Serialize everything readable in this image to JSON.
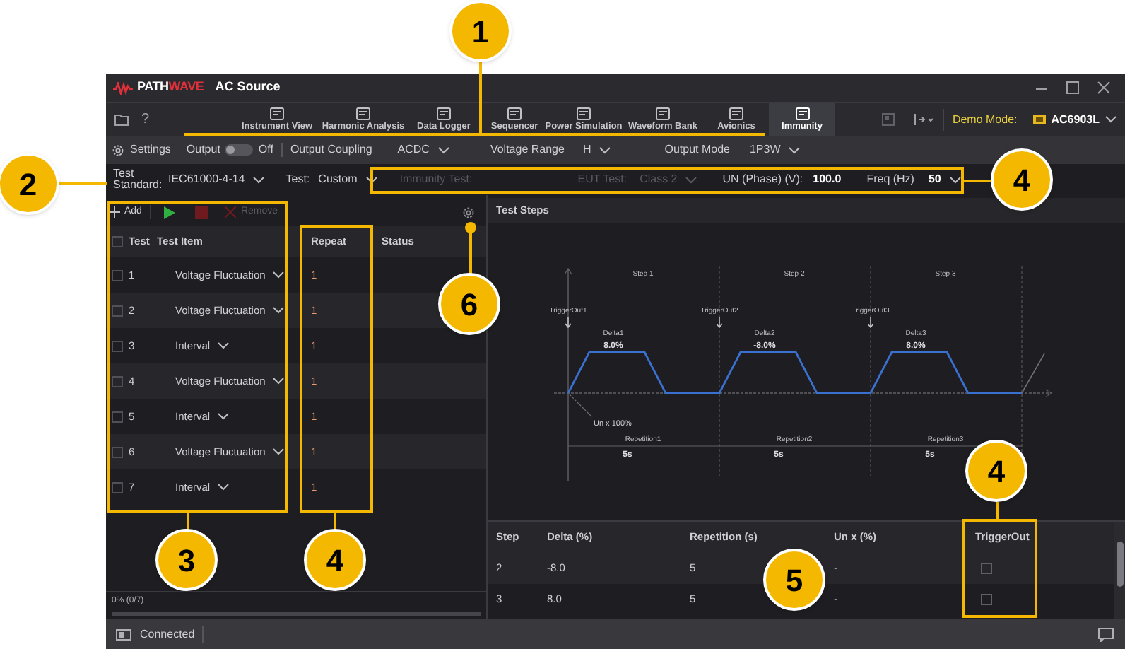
{
  "title_bar": {
    "logo_left": "PATH",
    "logo_right": "WAVE",
    "app_name": "AC Source"
  },
  "toolbar": {
    "tabs": [
      {
        "label": "Instrument View",
        "selected": false
      },
      {
        "label": "Harmonic Analysis",
        "selected": false
      },
      {
        "label": "Data Logger",
        "selected": false
      },
      {
        "label": "Sequencer",
        "selected": false
      },
      {
        "label": "Power Simulation",
        "selected": false
      },
      {
        "label": "Waveform Bank",
        "selected": false
      },
      {
        "label": "Avionics",
        "selected": false
      },
      {
        "label": "Immunity",
        "selected": true
      }
    ],
    "help": "?",
    "demo_mode_label": "Demo Mode:",
    "device": "AC6903L"
  },
  "settings_bar": {
    "settings": "Settings",
    "output_label": "Output",
    "output_on": false,
    "output_state": "Off",
    "coupling_label": "Output Coupling",
    "coupling": "ACDC",
    "range_label": "Voltage Range",
    "range": "H",
    "mode_label": "Output Mode",
    "mode": "1P3W"
  },
  "standard_bar": {
    "standard_label": "Test Standard:",
    "standard": "IEC61000-4-14",
    "test_label": "Test:",
    "test": "Custom",
    "immunity_label": "Immunity Test:",
    "eut_label": "EUT Test:",
    "eut": "Class 2",
    "eut_disabled": true,
    "un_label": "UN (Phase) (V):",
    "un": "100.0",
    "freq_label": "Freq (Hz)",
    "freq": "50"
  },
  "test_list": {
    "buttons": [
      {
        "kind": "add",
        "label": "Add",
        "disabled": false
      },
      {
        "kind": "run",
        "disabled": false
      },
      {
        "kind": "stop",
        "disabled": true
      },
      {
        "kind": "remove",
        "label": "Remove",
        "disabled": true
      }
    ],
    "all_checked": false,
    "columns": [
      "Test",
      "Test Item",
      "Repeat",
      "Status"
    ],
    "rows": [
      {
        "test": "1",
        "item": "Voltage Fluctuation",
        "repeat": "1",
        "checked": false
      },
      {
        "test": "2",
        "item": "Voltage Fluctuation",
        "repeat": "1",
        "checked": false
      },
      {
        "test": "3",
        "item": "Interval",
        "repeat": "1",
        "checked": false
      },
      {
        "test": "4",
        "item": "Voltage Fluctuation",
        "repeat": "1",
        "checked": false
      },
      {
        "test": "5",
        "item": "Interval",
        "repeat": "1",
        "checked": false
      },
      {
        "test": "6",
        "item": "Voltage Fluctuation",
        "repeat": "1",
        "checked": false
      },
      {
        "test": "7",
        "item": "Interval",
        "repeat": "1",
        "checked": false
      }
    ],
    "progress": {
      "text": "0% (0/7)",
      "level": 0
    }
  },
  "test_steps": {
    "title": "Test Steps",
    "diagram": {
      "steps": [
        {
          "step": "Step 1",
          "trigger": "TriggerOut1",
          "delta_label": "Delta1",
          "delta": "8.0%",
          "repetition_label": "Repetition1",
          "time": "5s"
        },
        {
          "step": "Step 2",
          "trigger": "TriggerOut2",
          "delta_label": "Delta2",
          "delta": "-8.0%",
          "repetition_label": "Repetition2",
          "time": "5s"
        },
        {
          "step": "Step 3",
          "trigger": "TriggerOut3",
          "delta_label": "Delta3",
          "delta": "8.0%",
          "repetition_label": "Repetition3",
          "time": "5s"
        }
      ],
      "un_label": "Un x 100%"
    },
    "table": {
      "columns": [
        "Step",
        "Delta (%)",
        "Repetition (s)",
        "Un x (%)",
        "TriggerOut"
      ],
      "rows": [
        {
          "step": "2",
          "delta": "-8.0",
          "repetition": "5",
          "un": "-",
          "trigger_out": false
        },
        {
          "step": "3",
          "delta": "8.0",
          "repetition": "5",
          "un": "-",
          "trigger_out": false
        }
      ]
    }
  },
  "status_bar": {
    "text": "Connected"
  },
  "callouts": [
    "1",
    "2",
    "3",
    "4",
    "4",
    "4",
    "5",
    "6"
  ]
}
